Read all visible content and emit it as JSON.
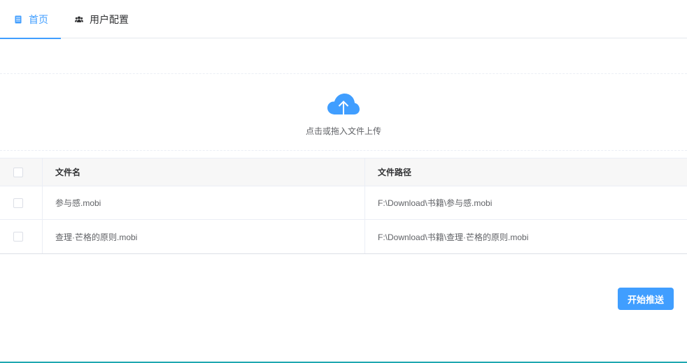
{
  "tabs": [
    {
      "label": "首页",
      "icon": "document-list-icon",
      "active": true
    },
    {
      "label": "用户配置",
      "icon": "users-icon",
      "active": false
    }
  ],
  "upload": {
    "icon": "cloud-upload-icon",
    "hint": "点击或拖入文件上传"
  },
  "table": {
    "columns": [
      "文件名",
      "文件路径"
    ],
    "rows": [
      {
        "name": "参与感.mobi",
        "path": "F:\\Download\\书籍\\参与感.mobi",
        "checked": false
      },
      {
        "name": "查理·芒格的原则.mobi",
        "path": "F:\\Download\\书籍\\查理·芒格的原则.mobi",
        "checked": false
      }
    ]
  },
  "actions": {
    "push_label": "开始推送"
  },
  "colors": {
    "accent": "#409eff",
    "border": "#ebeef5",
    "header_bg": "#f7f7f7",
    "bottom_line": "#1fa8b0"
  }
}
